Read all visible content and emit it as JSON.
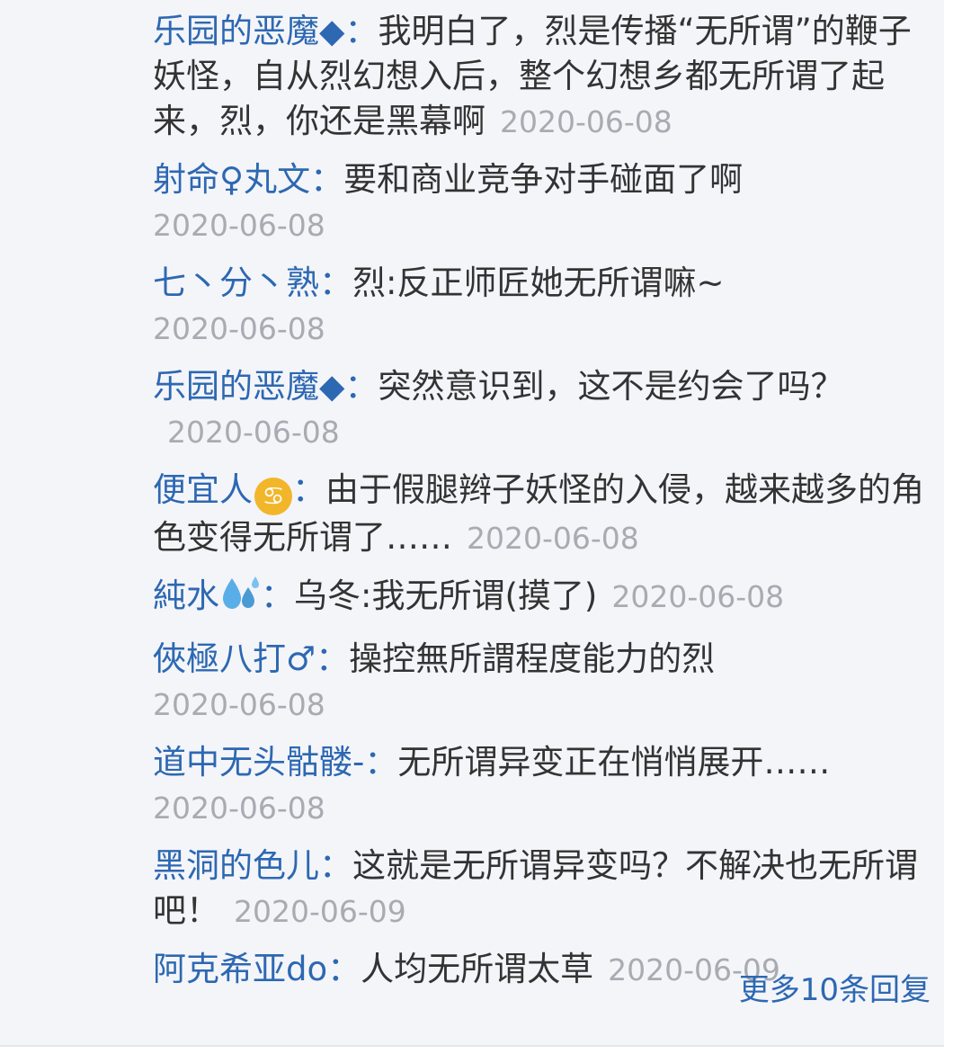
{
  "replies": [
    {
      "user": "乐园的恶魔◆",
      "colon": "：",
      "text": "我明白了，烈是传播“无所谓”的鞭子妖怪，自从烈幻想入后，整个幻想乡都无所谓了起来，烈，你还是黑幕啊",
      "date": "2020-06-08"
    },
    {
      "user": "射命♀丸文",
      "colon": "：",
      "text": "要和商业竞争对手碰面了啊",
      "date": "2020-06-08"
    },
    {
      "user": "七丶分丶熟",
      "colon": "：",
      "text": "烈:反正师匠她无所谓嘛~",
      "date": "2020-06-08"
    },
    {
      "user": "乐园的恶魔◆",
      "colon": "：",
      "text": "突然意识到，这不是约会了吗？",
      "date": "2020-06-08"
    },
    {
      "user": "便宜人",
      "user_emoji": "cancer-zodiac-icon",
      "colon": "：",
      "text": "由于假腿辫子妖怪的入侵，越来越多的角色变得无所谓了……",
      "date": "2020-06-08"
    },
    {
      "user": "純水",
      "user_emoji": "sweat-droplets-icon",
      "colon": "：",
      "text": "乌冬:我无所谓(摸了)",
      "date": "2020-06-08"
    },
    {
      "user": "俠極八打♂",
      "colon": "：",
      "text": "操控無所謂程度能力的烈",
      "date": "2020-06-08"
    },
    {
      "user": "道中无头骷髅-",
      "colon": "：",
      "text": "无所谓异变正在悄悄展开……",
      "date": "2020-06-08"
    },
    {
      "user": "黑洞的色儿",
      "colon": "：",
      "text": "这就是无所谓异变吗？不解决也无所谓吧！",
      "date": "2020-06-09"
    },
    {
      "user": "阿克希亚do",
      "colon": "：",
      "text": "人均无所谓太草",
      "date": "2020-06-09"
    }
  ],
  "more_replies_label": "更多10条回复",
  "colors": {
    "username": "#2d68b2",
    "text": "#333333",
    "date": "#a8abb2",
    "background": "#f4f5f9"
  }
}
